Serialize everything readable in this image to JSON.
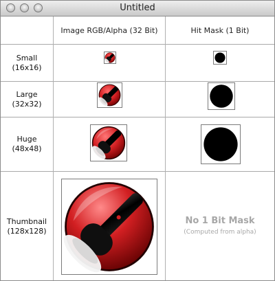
{
  "window": {
    "title": "Untitled"
  },
  "table": {
    "columns": [
      {
        "label": "Image RGB/Alpha (32 Bit)"
      },
      {
        "label": "Hit Mask (1 Bit)"
      }
    ],
    "rows": [
      {
        "label_line1": "Small",
        "label_line2": "(16x16)"
      },
      {
        "label_line1": "Large",
        "label_line2": "(32x32)"
      },
      {
        "label_line1": "Huge",
        "label_line2": "(48x48)"
      },
      {
        "label_line1": "Thumbnail",
        "label_line2": "(128x128)"
      }
    ]
  },
  "no_mask": {
    "title": "No 1 Bit Mask",
    "subtitle": "(Computed from alpha)"
  },
  "icons": {
    "rgb": "flashlight-icon",
    "mask": "mask-circle-icon"
  },
  "colors": {
    "red": "#d21f22",
    "dark_red": "#6b0000",
    "black": "#000000",
    "line": "#a8a8a8",
    "muted_text": "#a7a7a7"
  }
}
